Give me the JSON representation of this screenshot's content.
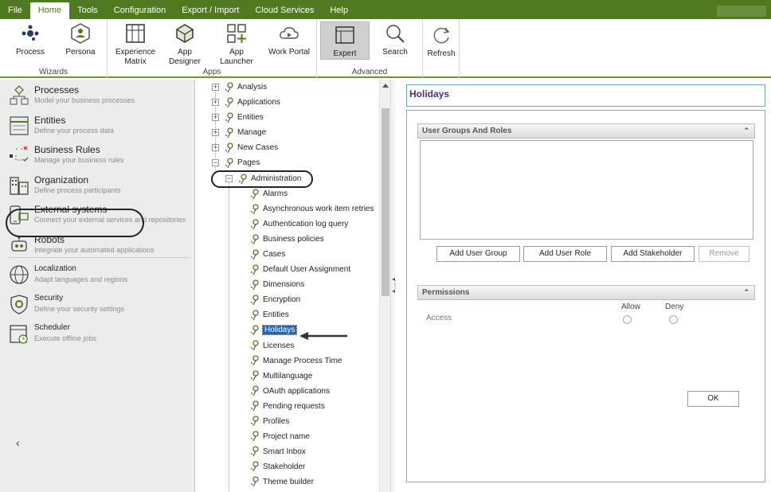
{
  "menubar": {
    "items": [
      "File",
      "Home",
      "Tools",
      "Configuration",
      "Export / Import",
      "Cloud Services",
      "Help"
    ],
    "active_index": 1
  },
  "ribbon": {
    "groups": {
      "wizards": {
        "label": "Wizards",
        "process": "Process",
        "persona": "Persona"
      },
      "apps": {
        "label": "Apps",
        "experience_matrix_1": "Experience",
        "experience_matrix_2": "Matrix",
        "app_designer": "App Designer",
        "app_launcher": "App Launcher",
        "work_portal": "Work Portal"
      },
      "advanced": {
        "label": "Advanced",
        "expert": "Expert",
        "search": "Search"
      },
      "refresh": "Refresh"
    }
  },
  "left_nav": {
    "items": [
      {
        "title": "Processes",
        "subtitle": "Model your business processes",
        "icon": "processes-icon"
      },
      {
        "title": "Entities",
        "subtitle": "Define your process data",
        "icon": "entities-icon"
      },
      {
        "title": "Business Rules",
        "subtitle": "Manage your business rules",
        "icon": "business-rules-icon"
      },
      {
        "title": "Organization",
        "subtitle": "Define process participants",
        "icon": "organization-icon"
      },
      {
        "title": "External systems",
        "subtitle": "Connect your external services and repositories",
        "icon": "external-systems-icon"
      },
      {
        "title": "Robots",
        "subtitle": "Integrate your automated applications",
        "icon": "robots-icon"
      },
      {
        "title": "Localization",
        "subtitle": "Adapt languages and regions",
        "icon": "localization-icon"
      },
      {
        "title": "Security",
        "subtitle": "Define your security settings",
        "icon": "security-icon"
      },
      {
        "title": "Scheduler",
        "subtitle": "Execute offline jobs",
        "icon": "scheduler-icon"
      }
    ]
  },
  "tree": {
    "top_nodes": [
      "Analysis",
      "Applications",
      "Entities",
      "Manage",
      "New Cases",
      "Pages"
    ],
    "admin_node": "Administration",
    "admin_children": [
      "Alarms",
      "Asynchronous work item retries",
      "Authentication log query",
      "Business policies",
      "Cases",
      "Default User Assignment",
      "Dimensions",
      "Encryption",
      "Entities",
      "Holidays",
      "Licenses",
      "Manage Process Time",
      "Multilanguage",
      "OAuth applications",
      "Pending requests",
      "Profiles",
      "Project name",
      "Smart Inbox",
      "Stakeholder",
      "Theme builder"
    ],
    "selected": "Holidays"
  },
  "detail": {
    "title": "Holidays",
    "user_groups_header": "User Groups And Roles",
    "buttons": {
      "add_user_group": "Add User Group",
      "add_user_role": "Add User Role",
      "add_stakeholder": "Add Stakeholder",
      "remove": "Remove"
    },
    "permissions_header": "Permissions",
    "allow": "Allow",
    "deny": "Deny",
    "access": "Access",
    "ok": "OK"
  },
  "colors": {
    "brand_green": "#4f7a1f",
    "selection_blue": "#1e63c8",
    "title_purple": "#4b2d82"
  }
}
